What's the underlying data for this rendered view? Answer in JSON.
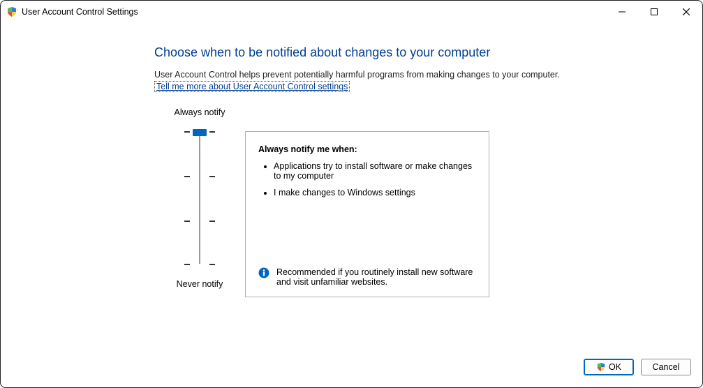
{
  "window": {
    "title": "User Account Control Settings"
  },
  "heading": "Choose when to be notified about changes to your computer",
  "subtext": "User Account Control helps prevent potentially harmful programs from making changes to your computer.",
  "help_link": "Tell me more about User Account Control settings",
  "slider": {
    "top_label": "Always notify",
    "bottom_label": "Never notify"
  },
  "panel": {
    "title": "Always notify me when:",
    "items": [
      "Applications try to install software or make changes to my computer",
      "I make changes to Windows settings"
    ],
    "recommendation": "Recommended if you routinely install new software and visit unfamiliar websites."
  },
  "buttons": {
    "ok": "OK",
    "cancel": "Cancel"
  }
}
